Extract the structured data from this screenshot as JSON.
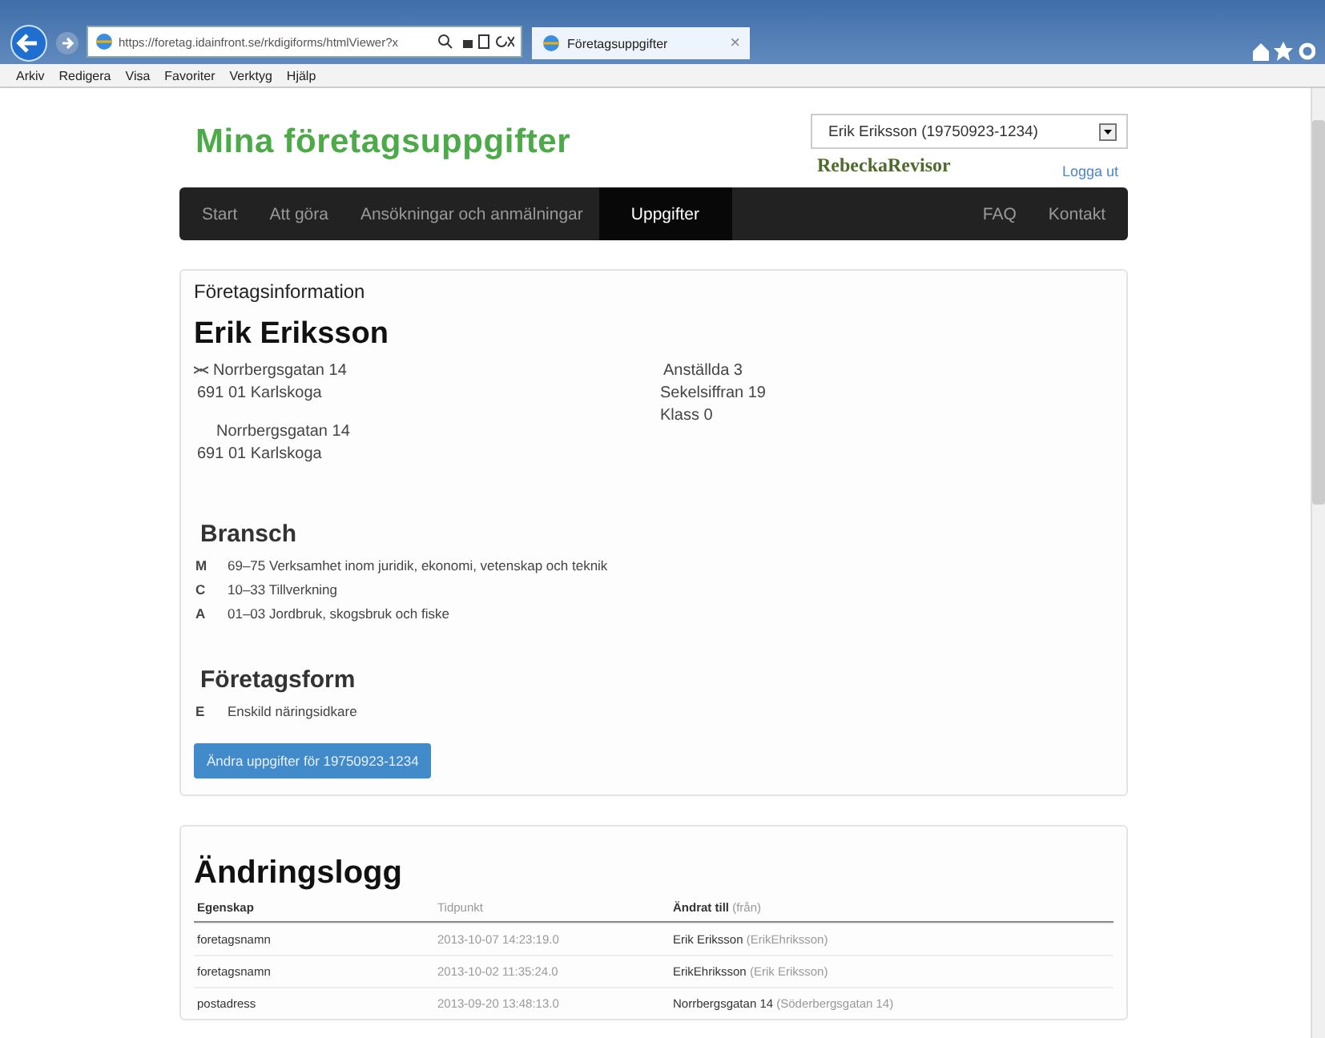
{
  "browser": {
    "url": "https://foretag.idainfront.se/rkdigiforms/htmlViewer?x",
    "tab": "Företagsuppgifter",
    "tab_close": "×",
    "menu": [
      "Arkiv",
      "Redigera",
      "Visa",
      "Favoriter",
      "Verktyg",
      "Hjälp"
    ]
  },
  "header": {
    "title": "Mina företagsuppgifter",
    "account_select": "Erik Eriksson (19750923-1234)",
    "user": "RebeckaRevisor",
    "logout": "Logga ut"
  },
  "nav": {
    "left": [
      {
        "label": "Start",
        "selected": false
      },
      {
        "label": "Att göra",
        "selected": false
      },
      {
        "label": "Ansökningar och anmälningar",
        "selected": false
      },
      {
        "label": "Uppgifter",
        "selected": true
      }
    ],
    "right": [
      {
        "label": "FAQ",
        "selected": false
      },
      {
        "label": "Kontakt",
        "selected": false
      }
    ]
  },
  "company": {
    "heading": "Företagsinformation",
    "name": "Erik Eriksson",
    "postal_address": [
      "Norrbergsgatan 14",
      "691 01 Karlskoga"
    ],
    "visiting_address": [
      "Norrbergsgatan 14",
      "691 01 Karlskoga"
    ],
    "facts": [
      "Anställda 3",
      "Sekelsiffran 19",
      "Klass 0"
    ],
    "industry_heading": "Bransch",
    "industries": [
      {
        "code": "M",
        "text": "69–75 Verksamhet inom juridik, ekonomi, vetenskap och teknik"
      },
      {
        "code": "C",
        "text": "10–33 Tillverkning"
      },
      {
        "code": "A",
        "text": "01–03 Jordbruk, skogsbruk och fiske"
      }
    ],
    "form_heading": "Företagsform",
    "forms": [
      {
        "code": "E",
        "text": "Enskild näringsidkare"
      }
    ],
    "edit_button": "Ändra uppgifter för 19750923-1234"
  },
  "changelog": {
    "heading": "Ändringslogg",
    "columns": {
      "property": "Egenskap",
      "time": "Tidpunkt",
      "to": "Ändrat till",
      "from": "(från)"
    },
    "rows": [
      {
        "property": "foretagsnamn",
        "time": "2013-10-07 14:23:19.0",
        "to": "Erik Eriksson",
        "from": "(ErikEhriksson)"
      },
      {
        "property": "foretagsnamn",
        "time": "2013-10-02 11:35:24.0",
        "to": "ErikEhriksson",
        "from": "(Erik Eriksson)"
      },
      {
        "property": "postadress",
        "time": "2013-09-20 13:48:13.0",
        "to": "Norrbergsgatan 14",
        "from": "(Söderbergsgatan 14)"
      }
    ]
  }
}
